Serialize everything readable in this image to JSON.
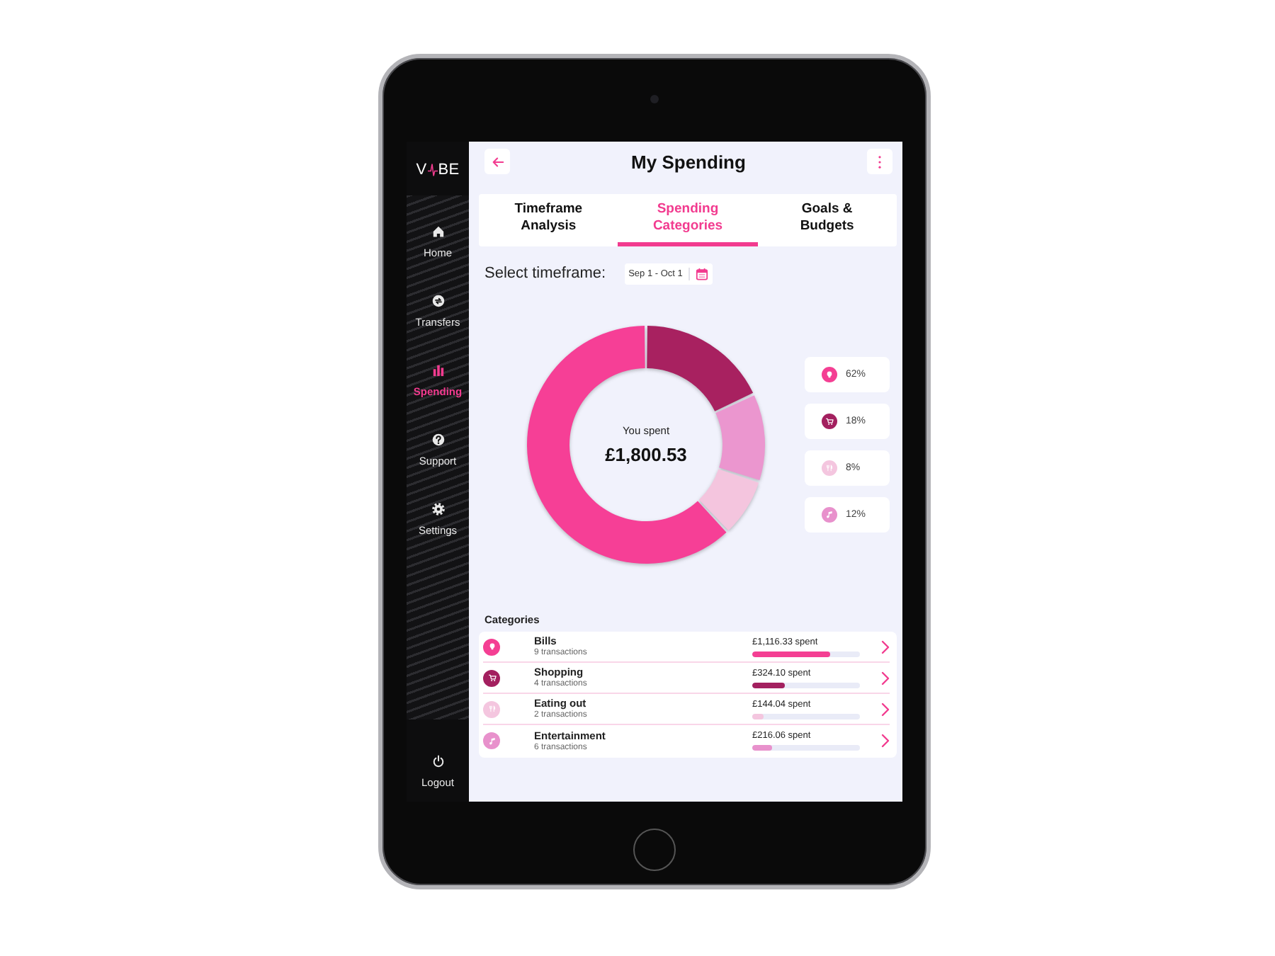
{
  "sidebar": {
    "logo": {
      "left": "V",
      "right": "BE"
    },
    "items": [
      {
        "label": "Home",
        "selected": false
      },
      {
        "label": "Transfers",
        "selected": false
      },
      {
        "label": "Spending",
        "selected": true
      },
      {
        "label": "Support",
        "selected": false
      },
      {
        "label": "Settings",
        "selected": false
      }
    ],
    "logout": "Logout"
  },
  "header": {
    "title": "My Spending"
  },
  "tabs": [
    {
      "label": "Timeframe Analysis",
      "selected": false
    },
    {
      "label": "Spending Categories",
      "selected": true
    },
    {
      "label": "Goals & Budgets",
      "selected": false
    }
  ],
  "timeframe": {
    "label": "Select timeframe:",
    "value": "Sep 1 - Oct 1"
  },
  "donut": {
    "caption": "You spent",
    "total": "£1,800.53",
    "chart_data": {
      "type": "donut",
      "values": [
        18,
        12,
        8,
        62
      ],
      "colors": [
        "#a82160",
        "#eb96cf",
        "#f4c5de",
        "#f63f96"
      ]
    }
  },
  "legend": [
    {
      "percent": "62%",
      "color": "#f43f93"
    },
    {
      "percent": "18%",
      "color": "#a3205f"
    },
    {
      "percent": "8%",
      "color": "#f4c6df"
    },
    {
      "percent": "12%",
      "color": "#e891cc"
    }
  ],
  "categories": {
    "title": "Categories",
    "rows": [
      {
        "name": "Bills",
        "transactions": "9 transactions",
        "amount": "£1,116.33 spent",
        "level": 0.72,
        "color": "#f43f93"
      },
      {
        "name": "Shopping",
        "transactions": "4 transactions",
        "amount": "£324.10 spent",
        "level": 0.3,
        "color": "#a3205f"
      },
      {
        "name": "Eating out",
        "transactions": "2 transactions",
        "amount": "£144.04 spent",
        "level": 0.1,
        "color": "#f4c6df"
      },
      {
        "name": "Entertainment",
        "transactions": "6 transactions",
        "amount": "£216.06 spent",
        "level": 0.19,
        "color": "#e891cc"
      }
    ]
  }
}
